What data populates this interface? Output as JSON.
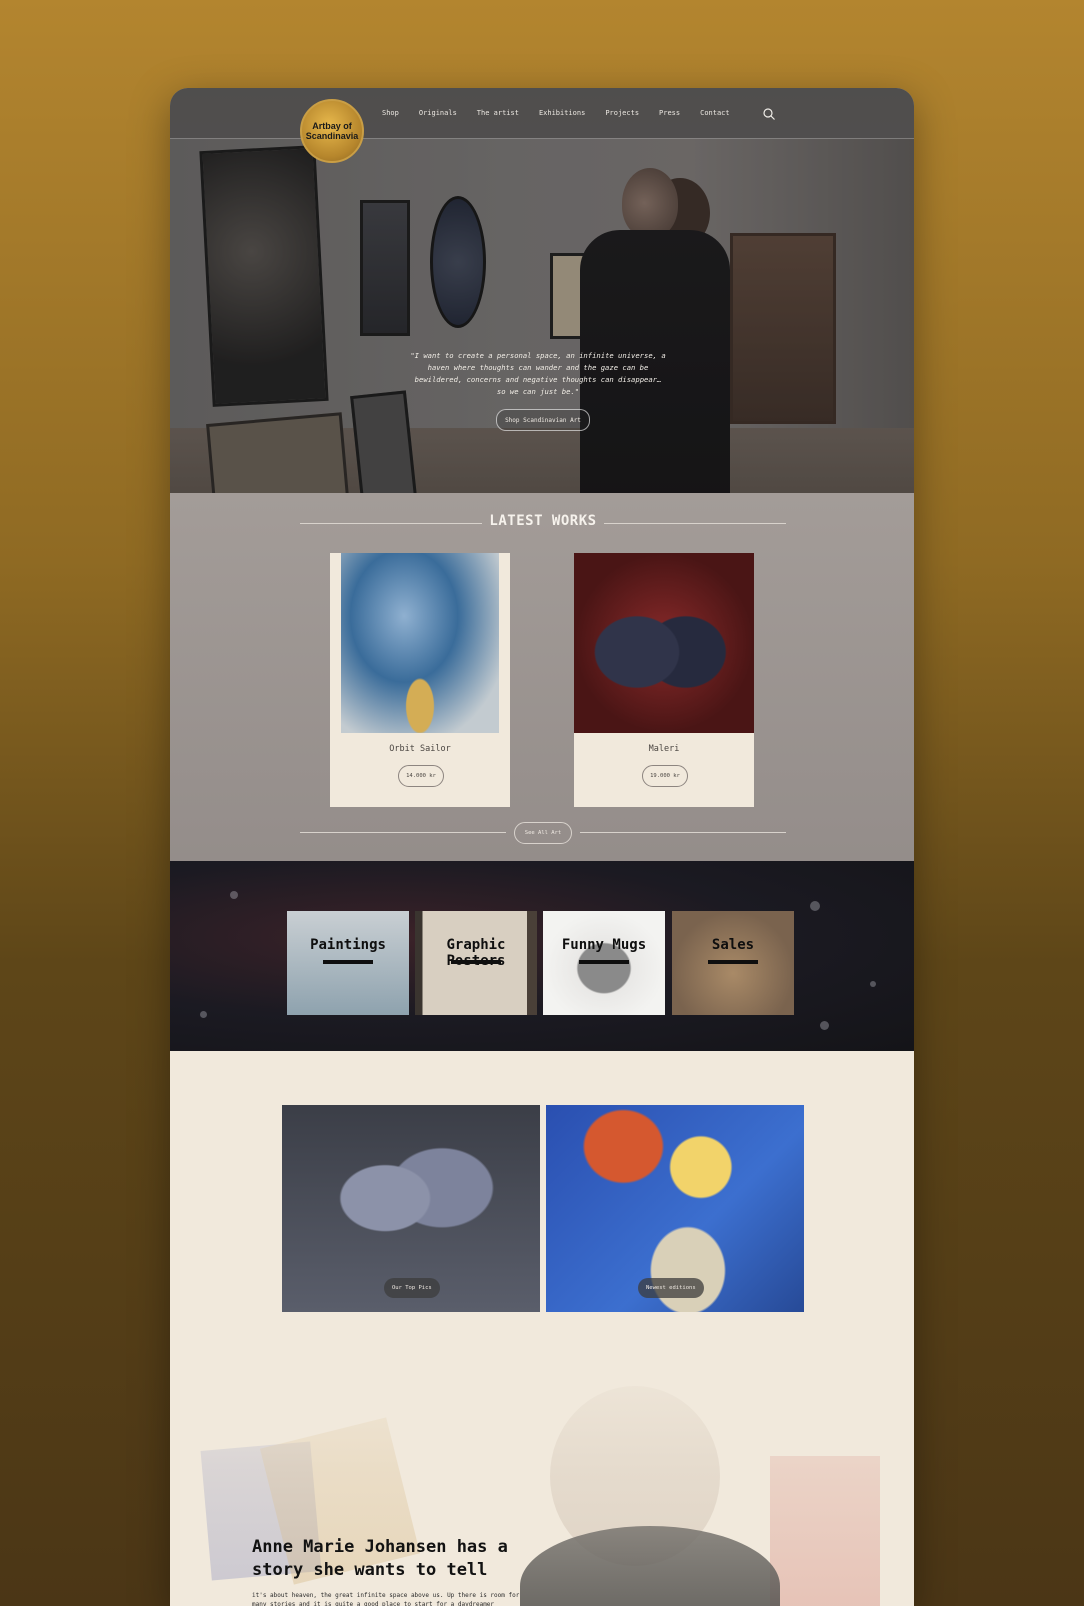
{
  "logo": {
    "text": "Artbay of Scandinavia"
  },
  "nav": {
    "items": [
      "Shop",
      "Originals",
      "The artist",
      "Exhibitions",
      "Projects",
      "Press",
      "Contact"
    ]
  },
  "hero": {
    "quote": "\"I want to create a personal space, an infinite universe, a haven where thoughts can wander and the gaze can be bewildered, concerns and negative thoughts can disappear… so we can just be.\"",
    "button": "Shop Scandinavian Art"
  },
  "latest": {
    "title": "LATEST WORKS",
    "cards": [
      {
        "name": "Orbit Sailor",
        "price": "14.000 kr"
      },
      {
        "name": "Maleri",
        "price": "19.000 kr"
      }
    ],
    "see_all": "See All Art"
  },
  "categories": [
    "Paintings",
    "Graphic Posters",
    "Funny Mugs",
    "Sales"
  ],
  "features": {
    "tile1": "Our Top Pics",
    "tile2": "Newest editions"
  },
  "story": {
    "title": "Anne Marie Johansen has a story she wants to tell",
    "text": "it's about heaven, the great infinite space above us. Up there is room for many stories and it is quite a good place to start for a daydreamer"
  },
  "colors": {
    "background_top": "#b3852f",
    "background_bottom": "#4b3616",
    "cream": "#f1e9dc",
    "latest_bg": "#9b9490"
  }
}
